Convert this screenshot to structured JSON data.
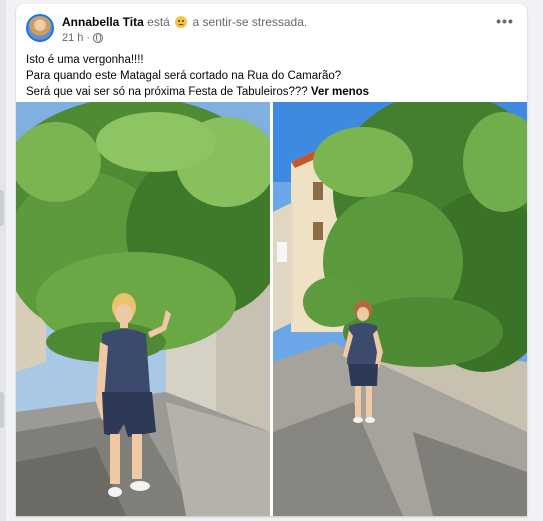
{
  "post": {
    "author": "Annabella Tita",
    "status_prefix": "está",
    "status_suffix": "a sentir-se stressada.",
    "feeling_icon": "stressed-face-icon",
    "time": "21 h",
    "separator": "·",
    "privacy_icon": "globe-icon",
    "more_label": "•••",
    "text_lines": [
      "Isto é uma vergonha!!!!",
      "Para quando este Matagal será cortado na Rua do Camarão?",
      "Será que vai ser só na próxima Festa de Tabuleiros???"
    ],
    "see_less": "Ver menos"
  },
  "photos": {
    "count": 2,
    "scene": "woman-under-overgrown-tree-on-cobblestone-street"
  },
  "colors": {
    "text": "#050505",
    "secondary": "#65676b",
    "background": "#f0f2f5",
    "card": "#ffffff",
    "link": "#1877f2"
  }
}
